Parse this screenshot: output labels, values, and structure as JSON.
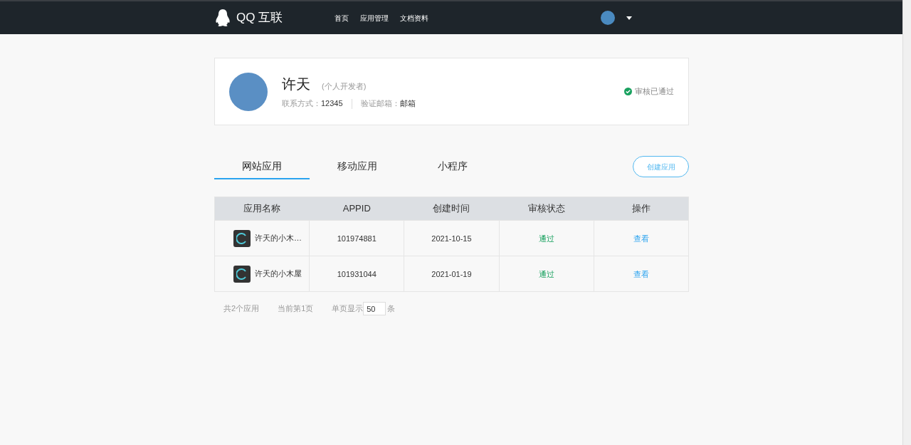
{
  "header": {
    "logo_text": "QQ 互联",
    "nav": [
      {
        "label": "首页"
      },
      {
        "label": "应用管理"
      },
      {
        "label": "文档资料"
      }
    ]
  },
  "profile": {
    "name": "许天",
    "role": "(个人开发者)",
    "contact_label": "联系方式：",
    "contact_value": "12345",
    "email_label": "验证邮箱：",
    "email_value": "邮箱",
    "status": "审核已通过"
  },
  "tabs": [
    {
      "label": "网站应用",
      "selected": true
    },
    {
      "label": "移动应用",
      "selected": false
    },
    {
      "label": "小程序",
      "selected": false
    }
  ],
  "create_button": "创建应用",
  "table": {
    "columns": [
      "应用名称",
      "APPID",
      "创建时间",
      "审核状态",
      "操作"
    ],
    "rows": [
      {
        "name": "许天的小木…",
        "appid": "101974881",
        "created": "2021-10-15",
        "status": "通过",
        "action": "查看"
      },
      {
        "name": "许天的小木屋",
        "appid": "101931044",
        "created": "2021-01-19",
        "status": "通过",
        "action": "查看"
      }
    ]
  },
  "pagination": {
    "total": "共2个应用",
    "current": "当前第1页",
    "per_page_label": "单页显示",
    "per_page_value": "50",
    "per_page_unit": "条"
  }
}
